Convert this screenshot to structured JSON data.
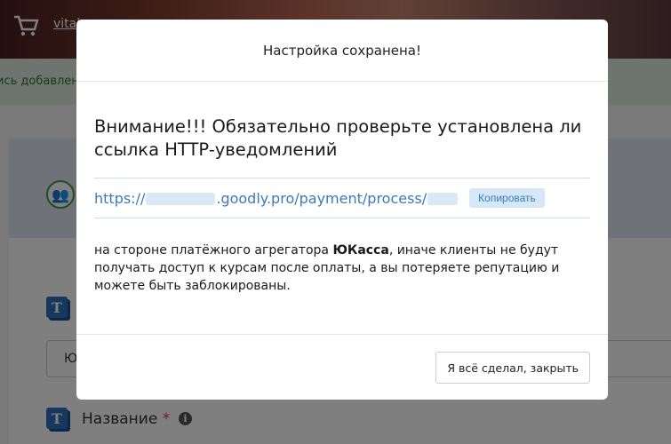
{
  "background": {
    "user_link": "vital",
    "alert_text": "ись добавлен",
    "select_value": "Ю",
    "field_label": "Название",
    "required_mark": "*",
    "info_icon_glyph": "i",
    "t_icon_glyph": "T",
    "group_icon_glyph": "👥",
    "colors": {
      "header": "#7a3a2c",
      "alert": "#dcebdc",
      "card_head": "#dfe6f1",
      "accent_blue": "#2d6fbd",
      "green": "#3f9a52"
    }
  },
  "modal": {
    "title": "Настройка сохранена!",
    "warning": "Внимание!!! Обязательно проверьте установлена ли ссылка HTTP-уведомлений",
    "url_part1": "https://",
    "url_part2": ".goodly.pro/payment/process/",
    "url_part3": "",
    "copy_label": "Копировать",
    "notice_before": "на стороне платёжного агрегатора ",
    "notice_brand": "ЮКасса",
    "notice_after": ", иначе клиенты не будут получать доступ к курсам после оплаты, а вы потеряете репутацию и можете быть заблокированы.",
    "close_label": "Я всё сделал, закрыть"
  }
}
